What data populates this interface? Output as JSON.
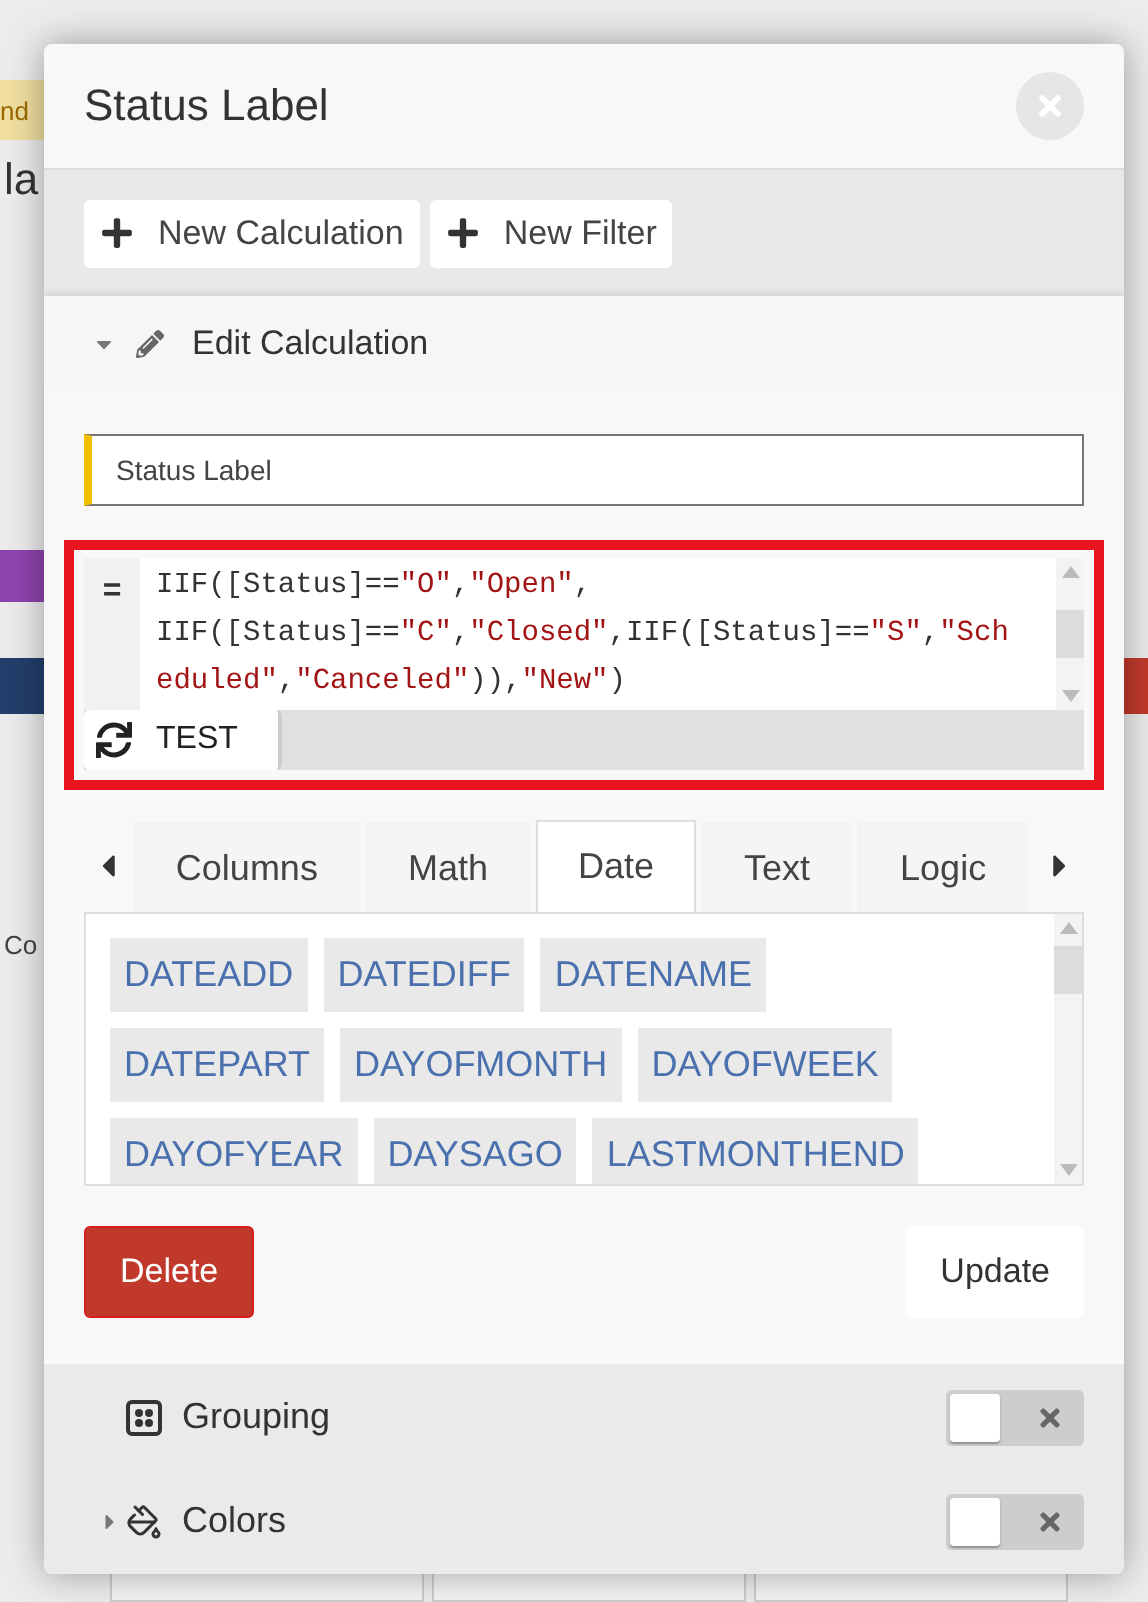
{
  "background": {
    "left_fragments": [
      "nd",
      "la",
      "Co"
    ]
  },
  "modal": {
    "title": "Status Label",
    "toolbar": [
      {
        "label": "New Calculation"
      },
      {
        "label": "New Filter"
      }
    ],
    "section": {
      "title": "Edit Calculation",
      "expanded": true
    },
    "name_field": {
      "value": "Status Label"
    },
    "formula": {
      "operator": "=",
      "lines": [
        [
          {
            "kind": "code",
            "text": "IIF([Status]=="
          },
          {
            "kind": "string",
            "text": "\"O\""
          },
          {
            "kind": "code",
            "text": ","
          },
          {
            "kind": "string",
            "text": "\"Open\""
          },
          {
            "kind": "code",
            "text": ","
          }
        ],
        [
          {
            "kind": "code",
            "text": "IIF([Status]=="
          },
          {
            "kind": "string",
            "text": "\"C\""
          },
          {
            "kind": "code",
            "text": ","
          },
          {
            "kind": "string",
            "text": "\"Closed\""
          },
          {
            "kind": "code",
            "text": ",IIF([Status]=="
          },
          {
            "kind": "string",
            "text": "\"S\""
          },
          {
            "kind": "code",
            "text": ","
          },
          {
            "kind": "string",
            "text": "\"Scheduled\""
          },
          {
            "kind": "code",
            "text": ","
          },
          {
            "kind": "string",
            "text": "\"Canceled\""
          },
          {
            "kind": "code",
            "text": ")),"
          },
          {
            "kind": "string",
            "text": "\"New\""
          },
          {
            "kind": "code",
            "text": ")"
          }
        ]
      ]
    },
    "test_button": "TEST",
    "tabs": [
      {
        "label": "Columns",
        "selected": false
      },
      {
        "label": "Math",
        "selected": false
      },
      {
        "label": "Date",
        "selected": true
      },
      {
        "label": "Text",
        "selected": false
      },
      {
        "label": "Logic",
        "selected": false
      }
    ],
    "functions": [
      [
        "DATEADD",
        "DATEDIFF",
        "DATENAME"
      ],
      [
        "DATEPART",
        "DAYOFMONTH",
        "DAYOFWEEK"
      ],
      [
        "DAYOFYEAR",
        "DAYSAGO",
        "LASTMONTHEND"
      ]
    ],
    "actions": {
      "delete": "Delete",
      "update": "Update"
    },
    "options": [
      {
        "kind": "grouping",
        "label": "Grouping",
        "on": false
      },
      {
        "kind": "colors",
        "label": "Colors",
        "on": false,
        "expanded": false
      }
    ]
  }
}
